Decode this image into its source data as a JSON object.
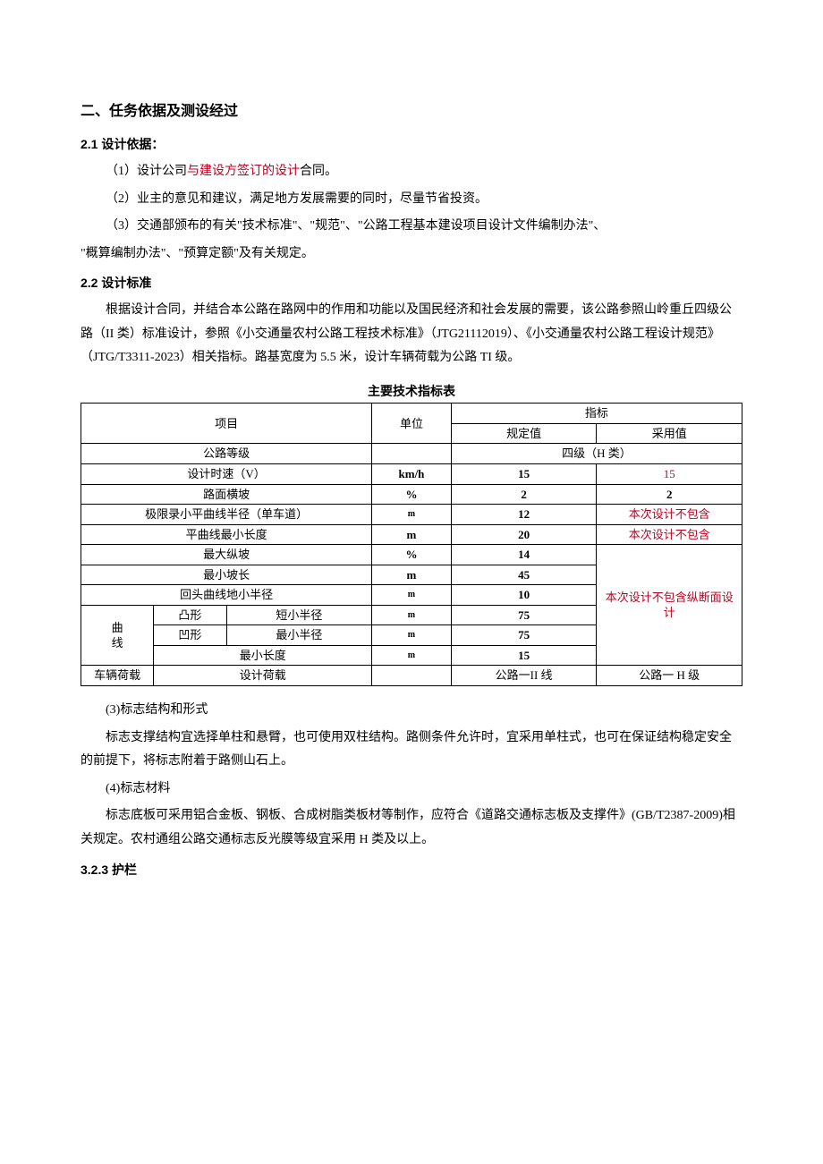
{
  "headings": {
    "h2": "二、任务依据及测设经过",
    "s21": "2.1 设计依据：",
    "s22": "2.2 设计标准",
    "s323": "3.2.3 护栏"
  },
  "s21": {
    "p1a": "（1）设计公司",
    "p1b": "与建设方签订的设计",
    "p1c": "合同。",
    "p2": "（2）业主的意见和建议，满足地方发展需要的同时，尽量节省投资。",
    "p3a": "（3）交通部颁布的有关\"技术标准\"、\"规范\"、\"公路工程基本建设项目设计文件编制办法\"、",
    "p3b": "\"概算编制办法\"、\"预算定额\"及有关规定。"
  },
  "s22": {
    "p1": "根据设计合同，并结合本公路在路网中的作用和功能以及国民经济和社会发展的需要，该公路参照山岭重丘四级公路（II 类）标准设计，参照《小交通量农村公路工程技术标准》（JTG21112019）、《小交通量农村公路工程设计规范》（JTG/T3311-2023）相关指标。路基宽度为 5.5 米，设计车辆荷载为公路 TI 级。"
  },
  "table": {
    "title": "主要技术指标表",
    "header": {
      "project": "项目",
      "unit": "单位",
      "indicator": "指标",
      "spec": "规定值",
      "adopt": "采用值"
    },
    "rows": {
      "grade": {
        "name": "公路等级",
        "unit": "",
        "value": "四级（H 类）"
      },
      "speed": {
        "name": "设计时速（V）",
        "unit": "km/h",
        "spec": "15",
        "adopt": "15"
      },
      "cross": {
        "name": "路面横坡",
        "unit": "%",
        "spec": "2",
        "adopt": "2"
      },
      "minR": {
        "name": "极限录小平曲线半径（单车道）",
        "unit": "m",
        "spec": "12",
        "adopt": "本次设计不包含"
      },
      "minLen": {
        "name": "平曲线最小长度",
        "unit": "m",
        "spec": "20",
        "adopt": "本次设计不包含"
      },
      "maxSlope": {
        "name": "最大纵坡",
        "unit": "%",
        "spec": "14"
      },
      "minSlopeLen": {
        "name": "最小坡长",
        "unit": "m",
        "spec": "45"
      },
      "turnR": {
        "name": "回头曲线地小半径",
        "unit": "m",
        "spec": "10"
      },
      "convexShort": {
        "group": "凸形",
        "name": "短小半径",
        "unit": "m",
        "spec": "75"
      },
      "concaveMin": {
        "group": "凹形",
        "name": "最小半径",
        "unit": "m",
        "spec": "75"
      },
      "curveMinLen": {
        "name": "最小长度",
        "unit": "m",
        "spec": "15"
      },
      "curveGroup": "曲\n线",
      "load": {
        "group": "车辆荷载",
        "name": "设计荷载",
        "unit": "",
        "spec": "公路一II 线",
        "adopt": "公路一 H 级"
      },
      "mergedNote": "本次设计不包含纵断面设计"
    }
  },
  "post": {
    "p3h": "(3)标志结构和形式",
    "p3": "标志支撑结构宜选择单柱和悬臂，也可使用双柱结构。路侧条件允许时，宜采用单柱式，也可在保证结构稳定安全的前提下，将标志附着于路侧山石上。",
    "p4h": "(4)标志材料",
    "p4": "标志底板可采用铝合金板、钢板、合成树脂类板材等制作，应符合《道路交通标志板及支撑件》(GB/T2387-2009)相关规定。农村通组公路交通标志反光膜等级宜采用 H 类及以上。"
  }
}
